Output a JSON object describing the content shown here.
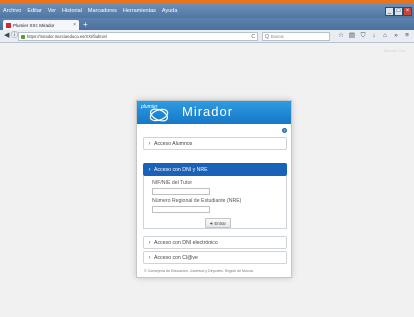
{
  "browser": {
    "menu": [
      "Archivo",
      "Editar",
      "Ver",
      "Historial",
      "Marcadores",
      "Herramientas",
      "Ayuda"
    ],
    "window_controls": [
      "_",
      "□",
      "×"
    ],
    "tab": {
      "title": "Plumier XXI: Mirador",
      "close": "×"
    },
    "new_tab": "+",
    "nav": {
      "back": "◀",
      "info": "ⓘ"
    },
    "url": "https://mirador.murciaeduca.es/XXI/fadmin/",
    "reload": "C",
    "search_placeholder": "Buscar",
    "search_icon": "Q",
    "toolbar_icons": [
      "☆",
      "▤",
      "⛉",
      "↓",
      "⌂",
      "»",
      "≡"
    ]
  },
  "page": {
    "faint_link": "Mirador Cla...",
    "header": {
      "logo_text": "plumier",
      "title": "Mirador"
    },
    "help_icon": "?",
    "accordion": [
      {
        "label": "Acceso Alumnos",
        "active": false
      },
      {
        "label": "Acceso con DNI y NRE",
        "active": true
      },
      {
        "label": "Acceso con DNI electrónico",
        "active": false
      },
      {
        "label": "Acceso con Cl@ve",
        "active": false
      }
    ],
    "chevron": "›",
    "form": {
      "nif_label": "NIF/NIE del Tutor",
      "nre_label": "Número Regional de Estudiante (NRE)",
      "submit_label": "Entrar",
      "submit_icon": "⎆"
    },
    "footer": "© Consejería de Educación, Juventud y Deportes. Región de Murcia"
  },
  "colors": {
    "accent_orange": "#e9731b",
    "header_blue": "#1778c6",
    "active_item": "#1a62b8"
  }
}
